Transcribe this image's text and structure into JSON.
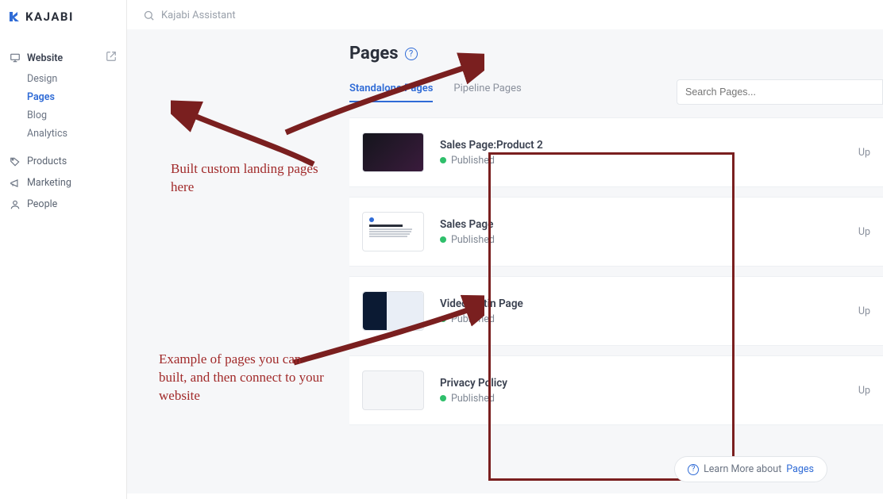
{
  "brand": {
    "name": "KAJABI"
  },
  "topSearch": {
    "placeholder": "Kajabi Assistant"
  },
  "sidebar": {
    "main": {
      "label": "Website"
    },
    "subs": [
      {
        "label": "Design"
      },
      {
        "label": "Pages"
      },
      {
        "label": "Blog"
      },
      {
        "label": "Analytics"
      }
    ],
    "products": {
      "label": "Products"
    },
    "marketing": {
      "label": "Marketing"
    },
    "people": {
      "label": "People"
    }
  },
  "page": {
    "title": "Pages",
    "tabs": [
      {
        "label": "Standalone Pages"
      },
      {
        "label": "Pipeline Pages"
      }
    ],
    "searchPlaceholder": "Search Pages...",
    "updatedPrefix": "Up"
  },
  "pages": [
    {
      "title": "Sales Page:Product 2",
      "status": "Published"
    },
    {
      "title": "Sales Page",
      "status": "Published"
    },
    {
      "title": "Video Optin Page",
      "status": "Published"
    },
    {
      "title": "Privacy Policy",
      "status": "Published"
    }
  ],
  "annotations": {
    "a1": "Built custom landing pages here",
    "a2": "Example of pages you can built, and then connect to your website"
  },
  "footer": {
    "text": "Learn More about ",
    "link": "Pages"
  }
}
